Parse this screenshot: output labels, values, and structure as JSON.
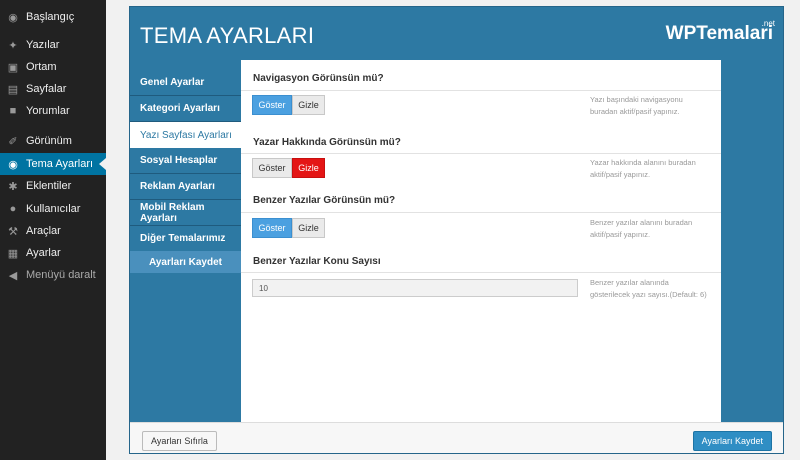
{
  "sidebar": {
    "items": [
      {
        "label": "Başlangıç",
        "icon": "dashboard-icon"
      },
      {
        "label": "Yazılar",
        "icon": "pin-icon"
      },
      {
        "label": "Ortam",
        "icon": "media-icon"
      },
      {
        "label": "Sayfalar",
        "icon": "pages-icon"
      },
      {
        "label": "Yorumlar",
        "icon": "comments-icon"
      },
      {
        "label": "Görünüm",
        "icon": "brush-icon"
      },
      {
        "label": "Tema Ayarları",
        "icon": "theme-icon"
      },
      {
        "label": "Eklentiler",
        "icon": "plugin-icon"
      },
      {
        "label": "Kullanıcılar",
        "icon": "users-icon"
      },
      {
        "label": "Araçlar",
        "icon": "tools-icon"
      },
      {
        "label": "Ayarlar",
        "icon": "settings-icon"
      },
      {
        "label": "Menüyü daralt",
        "icon": "collapse-icon"
      }
    ]
  },
  "panel": {
    "title": "TEMA AYARLARI",
    "brand": "WPTemalari",
    "brand_suffix": ".net"
  },
  "tabs": [
    {
      "label": "Genel Ayarlar"
    },
    {
      "label": "Kategori Ayarları"
    },
    {
      "label": "Yazı Sayfası Ayarları"
    },
    {
      "label": "Sosyal Hesaplar"
    },
    {
      "label": "Reklam Ayarları"
    },
    {
      "label": "Mobil Reklam Ayarları"
    },
    {
      "label": "Diğer Temalarımız"
    }
  ],
  "tab_save_label": "Ayarları Kaydet",
  "sections": [
    {
      "title": "Navigasyon Görünsün mü?",
      "show_label": "Göster",
      "hide_label": "Gizle",
      "help": "Yazı başındaki navigasyonu buradan aktif/pasif yapınız.",
      "selected": "show"
    },
    {
      "title": "Yazar Hakkında Görünsün mü?",
      "show_label": "Göster",
      "hide_label": "Gizle",
      "help": "Yazar hakkında alanını buradan aktif/pasif yapınız.",
      "selected": "hide"
    },
    {
      "title": "Benzer Yazılar Görünsün mü?",
      "show_label": "Göster",
      "hide_label": "Gizle",
      "help": "Benzer yazılar alanını buradan aktif/pasif yapınız.",
      "selected": "show"
    }
  ],
  "related_count": {
    "title": "Benzer Yazılar Konu Sayısı",
    "value": "10",
    "help": "Benzer yazılar alanında gösterilecek yazı sayısı.(Default: 6)"
  },
  "footer": {
    "reset_label": "Ayarları Sıfırla",
    "save_label": "Ayarları Kaydet"
  },
  "colors": {
    "panel_blue": "#2d79a3",
    "active_blue": "#4ba0e0",
    "active_red": "#e41515",
    "wp_active": "#0074a2"
  }
}
